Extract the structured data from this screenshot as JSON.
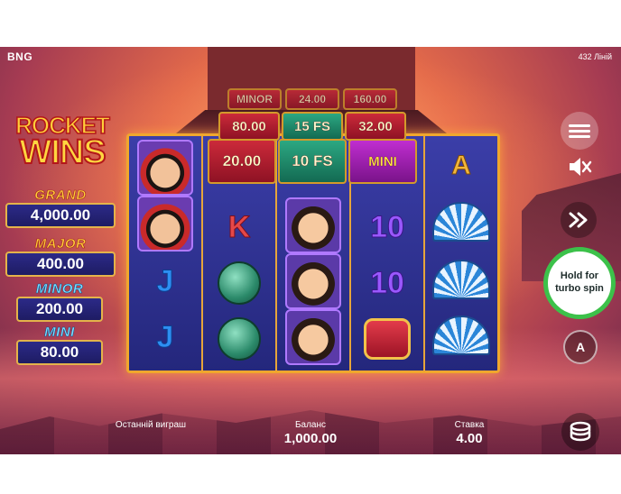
{
  "header": {
    "brand": "BNG",
    "lines": "432 Ліній"
  },
  "logo": {
    "line1": "ROCKET",
    "line2": "WINS"
  },
  "jackpots": [
    {
      "name": "GRAND",
      "value": "4,000.00"
    },
    {
      "name": "MAJOR",
      "value": "400.00"
    },
    {
      "name": "MINOR",
      "value": "200.00"
    },
    {
      "name": "MINI",
      "value": "80.00"
    }
  ],
  "multipliers": {
    "back_row": [
      "MINOR",
      "24.00",
      "160.00"
    ],
    "mid_row": [
      "80.00",
      "15 FS",
      "32.00"
    ],
    "front_row": [
      "20.00",
      "10 FS",
      "MINI"
    ]
  },
  "reels": {
    "reel1": [
      "portrait-man",
      "portrait-man",
      "J",
      "J"
    ],
    "reel2": [
      "K",
      "jade-pouch",
      "jade-pouch"
    ],
    "reel3": [
      "portrait-woman",
      "portrait-woman",
      "portrait-woman"
    ],
    "reel4": [
      "10",
      "10",
      "drum"
    ],
    "reel5": [
      "A",
      "fan",
      "fan",
      "fan"
    ]
  },
  "controls": {
    "spin_label_line1": "Hold for",
    "spin_label_line2": "turbo spin",
    "auto_label": "A"
  },
  "hud": {
    "last_win_label": "Останній виграш",
    "last_win_value": "",
    "balance_label": "Баланс",
    "balance_value": "1,000.00",
    "bet_label": "Ставка",
    "bet_value": "4.00"
  },
  "colors": {
    "accent_gold": "#f0a72d",
    "spin_green": "#3cc14a",
    "board_blue": "#2a2e8c"
  }
}
